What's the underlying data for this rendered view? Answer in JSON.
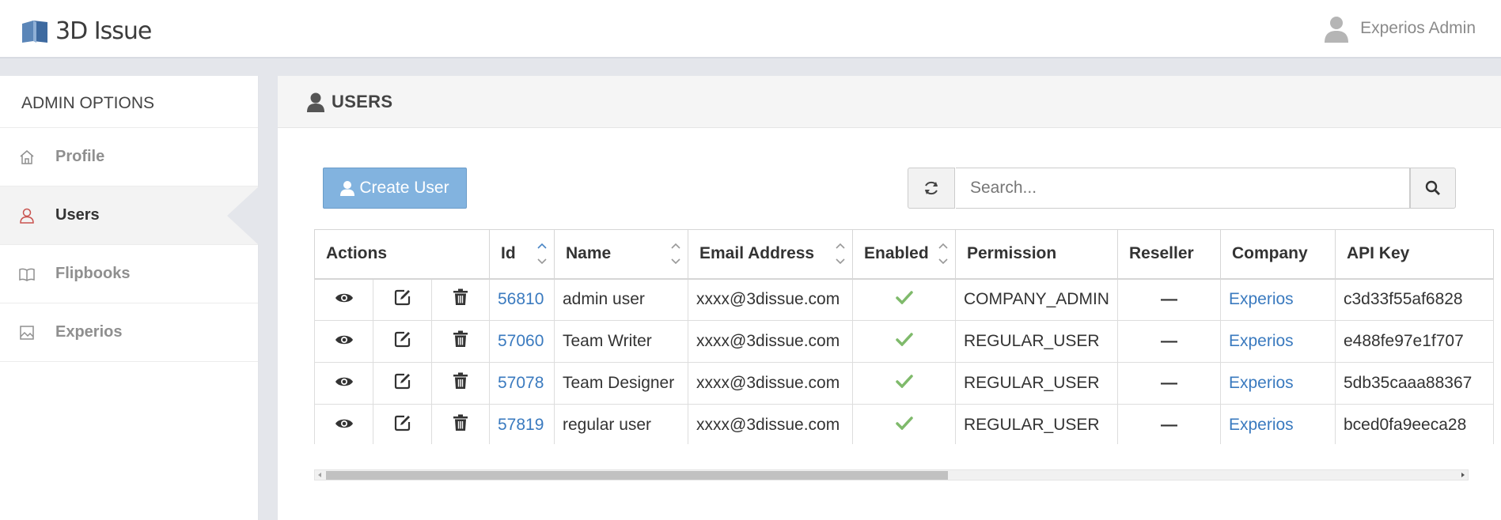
{
  "header": {
    "logo_text": "3D Issue",
    "user_name": "Experios Admin"
  },
  "sidebar": {
    "title": "ADMIN OPTIONS",
    "items": [
      {
        "label": "Profile",
        "icon": "home-icon"
      },
      {
        "label": "Users",
        "icon": "user-icon",
        "active": true
      },
      {
        "label": "Flipbooks",
        "icon": "book-icon"
      },
      {
        "label": "Experios",
        "icon": "image-icon"
      }
    ]
  },
  "main": {
    "title": "USERS",
    "create_button": "Create User",
    "search_placeholder": "Search...",
    "table": {
      "headers": [
        "Actions",
        "Id",
        "Name",
        "Email Address",
        "Enabled",
        "Permission",
        "Reseller",
        "Company",
        "API Key"
      ],
      "rows": [
        {
          "id": "56810",
          "name": "admin user",
          "email": "xxxx@3dissue.com",
          "enabled": true,
          "permission": "COMPANY_ADMIN",
          "reseller": "—",
          "company": "Experios",
          "api_key": "c3d33f55af6828"
        },
        {
          "id": "57060",
          "name": "Team Writer",
          "email": "xxxx@3dissue.com",
          "enabled": true,
          "permission": "REGULAR_USER",
          "reseller": "—",
          "company": "Experios",
          "api_key": "e488fe97e1f707"
        },
        {
          "id": "57078",
          "name": "Team Designer",
          "email": "xxxx@3dissue.com",
          "enabled": true,
          "permission": "REGULAR_USER",
          "reseller": "—",
          "company": "Experios",
          "api_key": "5db35caaa88367"
        },
        {
          "id": "57819",
          "name": "regular user",
          "email": "xxxx@3dissue.com",
          "enabled": true,
          "permission": "REGULAR_USER",
          "reseller": "—",
          "company": "Experios",
          "api_key": "bced0fa9eeca28"
        }
      ]
    }
  },
  "colors": {
    "accent": "#82b3df",
    "link": "#3a7abf",
    "check": "#7fba6b",
    "active_icon": "#c9534f"
  }
}
